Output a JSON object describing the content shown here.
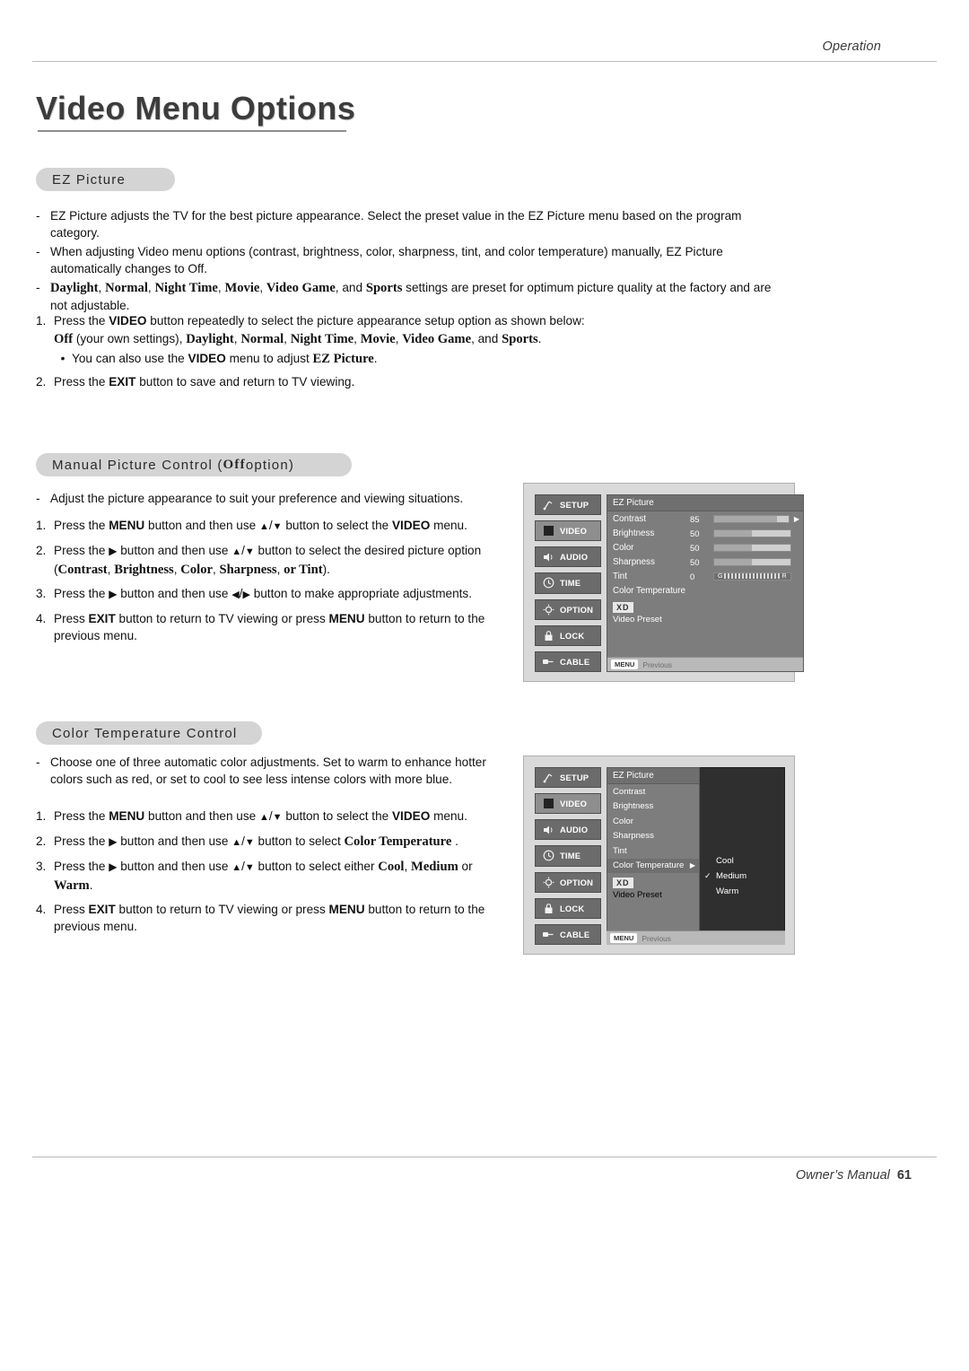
{
  "header": {
    "section": "Operation"
  },
  "page": {
    "title": "Video Menu Options",
    "footer_label": "Owner’s Manual",
    "footer_page": "61"
  },
  "sections": {
    "ez_picture": {
      "pill": "EZ Picture",
      "dashes": [
        "EZ Picture adjusts the TV for the best picture appearance. Select the preset value in the EZ Picture menu based on the program category.",
        "When adjusting Video menu options (contrast, brightness, color, sharpness, tint, and color temperature) manually, EZ Picture automatically changes to Off."
      ],
      "dash3_parts": {
        "a": "Daylight",
        "b": "Normal",
        "c": "Night Time",
        "d": "Movie",
        "e": "Video Game",
        "f": "and",
        "g": "Sports",
        "tail": "settings are preset for optimum picture quality at the factory and are not adjustable."
      },
      "steps": [
        {
          "num": "1.",
          "text_a": "Press the",
          "bold_a": "VIDEO",
          "text_b": "button repeatedly to select the picture appearance setup option as shown below:",
          "line2": {
            "off": "Off",
            "paren": "(your own settings),",
            "opts": [
              "Daylight",
              "Normal",
              "Night Time",
              "Movie",
              "Video Game"
            ],
            "and": "and",
            "sports": "Sports",
            "period": "."
          },
          "bullet": {
            "dot": "•",
            "a": "You can also use the",
            "bold_a": "VIDEO",
            "b": "menu to adjust",
            "bold_b": "EZ Picture",
            "c": "."
          }
        },
        {
          "num": "2.",
          "text_a": "Press the",
          "bold_a": "EXIT",
          "text_b": "button to save and return to TV viewing."
        }
      ]
    },
    "manual_picture": {
      "pill_a": "Manual Picture Control (",
      "pill_bold": "Off",
      "pill_b": " option)",
      "dash": "Adjust the picture appearance to suit your preference and viewing situations.",
      "steps": [
        {
          "num": "1.",
          "a": "Press the",
          "b_menu": "MENU",
          "c": "button and then use",
          "up": "▲",
          "slash": "/",
          "down": "▼",
          "d": "button to select the",
          "b_video": "VIDEO",
          "e": "menu."
        },
        {
          "num": "2.",
          "a": "Press the",
          "arrow": "▶",
          "c": "button and then use",
          "up": "▲",
          "slash": "/",
          "down": "▼",
          "d": "button to select the desired picture option",
          "line2": {
            "open": "(",
            "opts": [
              "Contrast",
              "Brightness",
              "Color",
              "Sharpness",
              "or Tint"
            ],
            "close": ")."
          }
        },
        {
          "num": "3.",
          "a": "Press the",
          "arrow": "▶",
          "c": "button and then use",
          "left": "◀",
          "slash": "/",
          "right": "▶",
          "d": "button to make appropriate adjustments."
        },
        {
          "num": "4.",
          "a": "Press",
          "b_exit": "EXIT",
          "c": "button to return to TV viewing or press",
          "b_menu": "MENU",
          "d": "button to return to the previous menu."
        }
      ]
    },
    "color_temperature": {
      "pill": "Color Temperature Control",
      "dash": "Choose one of three automatic color adjustments. Set to warm to enhance hotter colors such as red, or set to cool to see less intense colors with more blue.",
      "steps": [
        {
          "num": "1.",
          "a": "Press the",
          "b_menu": "MENU",
          "c": "button and then use",
          "up": "▲",
          "slash": "/",
          "down": "▼",
          "d": "button to select the",
          "b_video": "VIDEO",
          "e": "menu."
        },
        {
          "num": "2.",
          "a": "Press the",
          "arrow": "▶",
          "c": "button and then use",
          "up": "▲",
          "slash": "/",
          "down": "▼",
          "d": "button to select",
          "b_ct": "Color Temperature",
          "e": "."
        },
        {
          "num": "3.",
          "a": "Press the",
          "arrow": "▶",
          "c": "button and then use",
          "up": "▲",
          "slash": "/",
          "down": "▼",
          "d": "button to select either",
          "b_cool": "Cool",
          "comma": ",",
          "b_medium": "Medium",
          "or": "or",
          "b_warm": "Warm",
          "period": "."
        },
        {
          "num": "4.",
          "a": "Press",
          "b_exit": "EXIT",
          "c": "button to return to TV viewing or press",
          "b_menu": "MENU",
          "d": "button to return to the previous menu."
        }
      ]
    }
  },
  "osd1": {
    "tabs": [
      {
        "label": "SETUP",
        "icon": "antenna-icon",
        "selected": false
      },
      {
        "label": "VIDEO",
        "icon": "screen-icon",
        "selected": true
      },
      {
        "label": "AUDIO",
        "icon": "speaker-icon",
        "selected": false
      },
      {
        "label": "TIME",
        "icon": "clock-icon",
        "selected": false
      },
      {
        "label": "OPTION",
        "icon": "gear-icon",
        "selected": false
      },
      {
        "label": "LOCK",
        "icon": "lock-icon",
        "selected": false
      },
      {
        "label": "CABLE",
        "icon": "cable-icon",
        "selected": false
      }
    ],
    "title": "EZ Picture",
    "rows": [
      {
        "name": "Contrast",
        "value": "85",
        "fill": 85,
        "type": "slider",
        "arrow": "▶"
      },
      {
        "name": "Brightness",
        "value": "50",
        "fill": 50,
        "type": "slider",
        "arrow": ""
      },
      {
        "name": "Color",
        "value": "50",
        "fill": 50,
        "type": "slider",
        "arrow": ""
      },
      {
        "name": "Sharpness",
        "value": "50",
        "fill": 50,
        "type": "slider",
        "arrow": ""
      },
      {
        "name": "Tint",
        "value": "0",
        "fill": 0,
        "type": "tint",
        "arrow": "",
        "left_end": "G",
        "right_end": "R"
      },
      {
        "name": "Color Temperature",
        "value": "",
        "fill": 0,
        "type": "label",
        "arrow": ""
      }
    ],
    "xd_mark": "XD",
    "video_preset": "Video Preset",
    "footer": {
      "menu": "MENU",
      "previous": "Previous"
    }
  },
  "osd2": {
    "tabs": [
      {
        "label": "SETUP",
        "icon": "antenna-icon",
        "selected": false
      },
      {
        "label": "VIDEO",
        "icon": "screen-icon",
        "selected": true
      },
      {
        "label": "AUDIO",
        "icon": "speaker-icon",
        "selected": false
      },
      {
        "label": "TIME",
        "icon": "clock-icon",
        "selected": false
      },
      {
        "label": "OPTION",
        "icon": "gear-icon",
        "selected": false
      },
      {
        "label": "LOCK",
        "icon": "lock-icon",
        "selected": false
      },
      {
        "label": "CABLE",
        "icon": "cable-icon",
        "selected": false
      }
    ],
    "title": "EZ Picture",
    "rows": [
      "Contrast",
      "Brightness",
      "Color",
      "Sharpness",
      "Tint"
    ],
    "highlight_row": {
      "label": "Color Temperature",
      "arrow": "▶"
    },
    "options": [
      {
        "label": "Cool",
        "checked": false
      },
      {
        "label": "Medium",
        "checked": true
      },
      {
        "label": "Warm",
        "checked": false
      }
    ],
    "check_glyph": "✓",
    "xd_mark": "XD",
    "video_preset": "Video Preset",
    "footer": {
      "menu": "MENU",
      "previous": "Previous"
    }
  }
}
